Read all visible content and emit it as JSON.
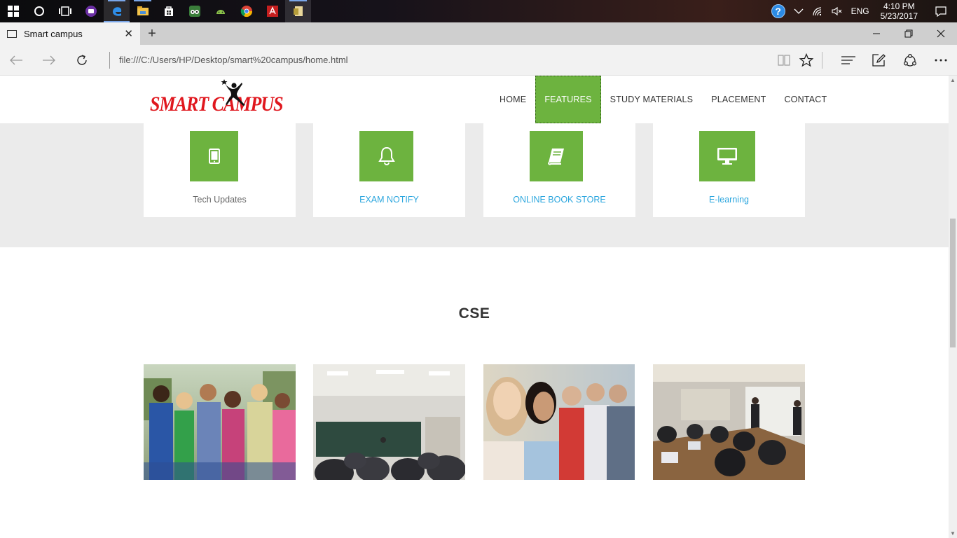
{
  "taskbar": {
    "apps": [
      "start-icon",
      "cortana-icon",
      "task-view-icon",
      "app-purple-icon",
      "edge-icon",
      "file-explorer-icon",
      "store-icon",
      "tripadvisor-icon",
      "android-icon",
      "chrome-icon",
      "acrobat-icon",
      "file-manager-icon"
    ],
    "tray": {
      "language": "ENG",
      "time": "4:10 PM",
      "date": "5/23/2017"
    }
  },
  "browser": {
    "tab_title": "Smart campus",
    "new_tab_symbol": "+",
    "address": "file:///C:/Users/HP/Desktop/smart%20campus/home.html"
  },
  "site": {
    "logo_text": "SMART CAMPUS",
    "menu": [
      {
        "label": "HOME"
      },
      {
        "label": "FEATURES"
      },
      {
        "label": "STUDY MATERIALS"
      },
      {
        "label": "PLACEMENT"
      },
      {
        "label": "CONTACT"
      }
    ],
    "features": [
      {
        "label": "Tech Updates",
        "icon": "tablet-icon"
      },
      {
        "label": "EXAM NOTIFY",
        "icon": "bell-icon"
      },
      {
        "label": "ONLINE BOOK STORE",
        "icon": "book-icon"
      },
      {
        "label": "E-learning",
        "icon": "monitor-icon"
      }
    ],
    "section_title": "CSE",
    "photos": [
      "students-group-photo",
      "classroom-lecture-photo",
      "students-line-photo",
      "computer-lab-photo"
    ]
  },
  "colors": {
    "accent_green": "#6db33f",
    "link_blue": "#2ba6de",
    "logo_red": "#e0171e",
    "band_gray": "#ebebeb"
  }
}
